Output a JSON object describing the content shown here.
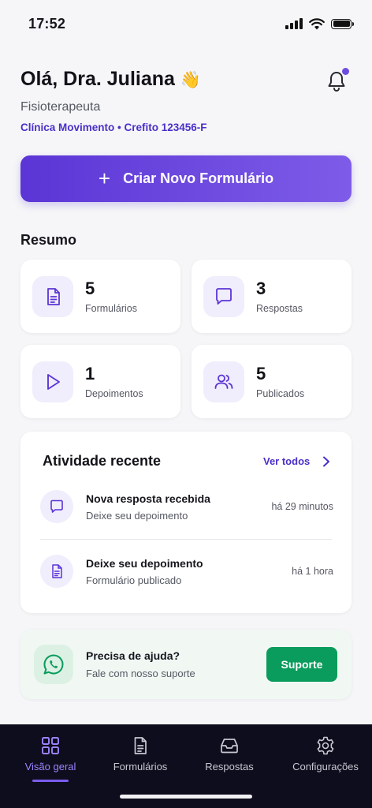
{
  "status_bar": {
    "time": "17:52"
  },
  "header": {
    "greeting": "Olá, Dra. Juliana",
    "wave_emoji": "👋",
    "role": "Fisioterapeuta",
    "clinic": "Clínica Movimento • Crefito 123456-F"
  },
  "cta": {
    "plus": "+",
    "label": "Criar Novo Formulário"
  },
  "summary": {
    "title": "Resumo",
    "stats": [
      {
        "value": "5",
        "label": "Formulários",
        "icon": "document-icon"
      },
      {
        "value": "3",
        "label": "Respostas",
        "icon": "chat-bubble-icon"
      },
      {
        "value": "1",
        "label": "Depoimentos",
        "icon": "play-icon"
      },
      {
        "value": "5",
        "label": "Publicados",
        "icon": "users-icon"
      }
    ]
  },
  "activity": {
    "title": "Atividade recente",
    "see_all": "Ver todos",
    "items": [
      {
        "title": "Nova resposta recebida",
        "subtitle": "Deixe seu depoimento",
        "time": "há 29 minutos",
        "icon": "chat-bubble-icon"
      },
      {
        "title": "Deixe seu depoimento",
        "subtitle": "Formulário publicado",
        "time": "há 1 hora",
        "icon": "document-icon"
      }
    ]
  },
  "help": {
    "title": "Precisa de ajuda?",
    "subtitle": "Fale com nosso suporte",
    "button": "Suporte",
    "icon": "whatsapp-icon"
  },
  "tabs": [
    {
      "label": "Visão geral",
      "icon": "grid-icon",
      "active": true
    },
    {
      "label": "Formulários",
      "icon": "document-icon",
      "active": false
    },
    {
      "label": "Respostas",
      "icon": "inbox-icon",
      "active": false
    },
    {
      "label": "Configurações",
      "icon": "gear-icon",
      "active": false
    }
  ],
  "colors": {
    "accent": "#5b35d5",
    "accent_light": "#f0edfc",
    "tab_bar": "#0e0d1d",
    "whatsapp_green": "#0a9c5c"
  }
}
